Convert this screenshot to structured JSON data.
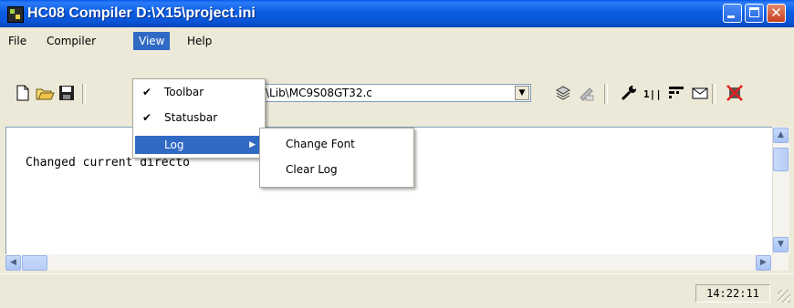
{
  "window": {
    "title": "HC08 Compiler  D:\\X15\\project.ini",
    "controls": [
      "minimize-icon",
      "maximize-icon",
      "close-icon"
    ]
  },
  "menubar": {
    "items": [
      {
        "label": "File",
        "active": false
      },
      {
        "label": "Compiler",
        "active": false
      },
      {
        "label": "View",
        "active": true
      },
      {
        "label": "Help",
        "active": false
      }
    ]
  },
  "view_menu": {
    "items": [
      {
        "label": "Toolbar",
        "checked": true
      },
      {
        "label": "Statusbar",
        "checked": true
      },
      {
        "label": "Log",
        "submenu": true,
        "highlighted": true
      }
    ]
  },
  "log_submenu": {
    "items": [
      {
        "label": "Change Font"
      },
      {
        "label": "Clear Log"
      }
    ]
  },
  "toolbar": {
    "file_combo_value": "\\Lib\\MC9S08GT32.c",
    "icons": [
      "new-file-icon",
      "open-folder-icon",
      "save-icon",
      "compile-icon",
      "stop-icon",
      "options-wrench-icon",
      "bits-icon",
      "layout-icon",
      "message-icon",
      "error-filter-icon"
    ]
  },
  "log": {
    "text": "Changed current directo"
  },
  "statusbar": {
    "time": "14:22:11"
  },
  "colors": {
    "titlebar": "#0A55D6",
    "highlight": "#316AC5",
    "chrome": "#ECE9D8"
  }
}
